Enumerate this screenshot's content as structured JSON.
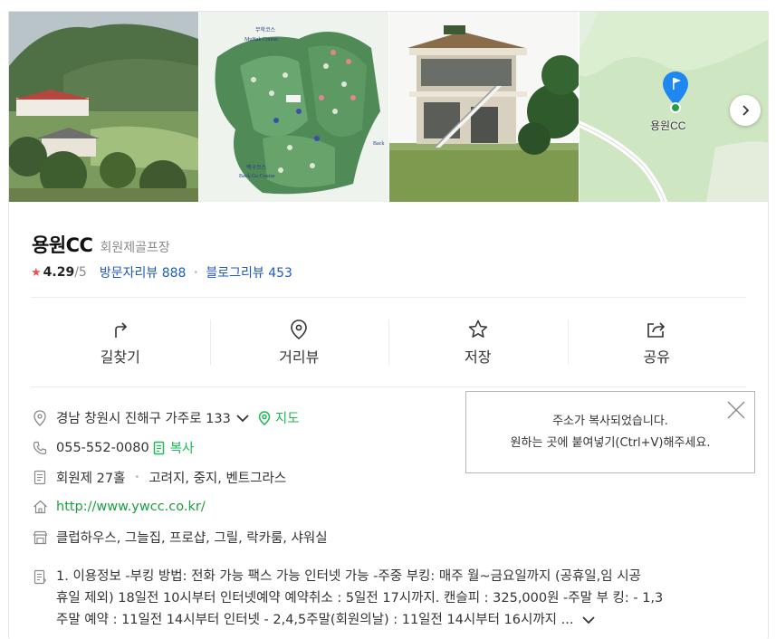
{
  "photos": {
    "course_map_labels": [
      "무학코스",
      "MuHak Course",
      "백구코스",
      "Back Gu Course",
      "Back"
    ],
    "map_pin_label": "용원CC",
    "next_icon": "chevron-right-icon"
  },
  "place": {
    "name": "용원CC",
    "category": "회원제골프장",
    "rating": "4.29",
    "rating_max": "/5",
    "visitor_reviews_label": "방문자리뷰",
    "visitor_reviews_count": "888",
    "blog_reviews_label": "블로그리뷰",
    "blog_reviews_count": "453"
  },
  "actions": [
    {
      "label": "길찾기",
      "icon": "directions-icon"
    },
    {
      "label": "거리뷰",
      "icon": "location-pin-icon"
    },
    {
      "label": "저장",
      "icon": "star-icon"
    },
    {
      "label": "공유",
      "icon": "share-icon"
    }
  ],
  "info": {
    "address": "경남 창원시 진해구 가주로 133",
    "map_label": "지도",
    "phone": "055-552-0080",
    "copy_label": "복사",
    "holes": "회원제 27홀",
    "course_names": "고려지, 중지, 벤트그라스",
    "website": "http://www.ywcc.co.kr/",
    "facilities": "클럽하우스, 그늘집, 프로샵, 그릴, 락카룸, 샤워실",
    "description_lines": [
      "1. 이용정보 -부킹 방법: 전화 가능 팩스 가능 인터넷 가능 -주중 부킹: 매주 월~금요일까지 (공휴일,임 시공",
      "휴일 제외) 18일전 10시부터 인터넷예약 예약취소 : 5일전 17시까지. 캔슬피 : 325,000원 -주말 부 킹: - 1,3",
      "주말 예약 : 11일전 14시부터 인터넷 - 2,4,5주말(회원의날) : 11일전 14시부터 16시까지 ..."
    ]
  },
  "toast": {
    "line1": "주소가 복사되었습니다.",
    "line2": "원하는 곳에 붙여넣기(Ctrl+V)해주세요."
  },
  "colors": {
    "link_blue": "#1f5bbf",
    "green": "#1db954",
    "star_red": "#f0514a",
    "map_pin_blue": "#1e88f0"
  }
}
